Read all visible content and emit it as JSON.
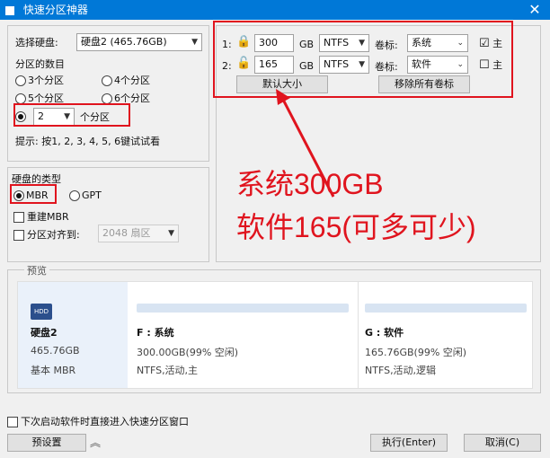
{
  "window": {
    "title": "快速分区神器",
    "close_glyph": "✕"
  },
  "disk": {
    "select_label": "选择硬盘:",
    "selected": "硬盘2 (465.76GB)",
    "count_label": "分区的数目",
    "options": [
      "3个分区",
      "4个分区",
      "5个分区",
      "6个分区"
    ],
    "custom_value": "2",
    "custom_suffix": "个分区",
    "hint": "提示: 按1, 2, 3, 4, 5, 6键试试看"
  },
  "disk_type": {
    "label": "硬盘的类型",
    "mbr": "MBR",
    "gpt": "GPT",
    "rebuild_mbr": "重建MBR",
    "align_label": "分区对齐到:",
    "align_value": "2048 扇区"
  },
  "partitions": [
    {
      "index": "1:",
      "size": "300",
      "unit": "GB",
      "fs": "NTFS",
      "label_caption": "卷标:",
      "label": "系统",
      "main_label": "主",
      "main_checked": "☑"
    },
    {
      "index": "2:",
      "size": "165",
      "unit": "GB",
      "fs": "NTFS",
      "label_caption": "卷标:",
      "label": "软件",
      "main_label": "主",
      "main_checked": "☐"
    }
  ],
  "partition_buttons": {
    "default_size": "默认大小",
    "remove_labels": "移除所有卷标"
  },
  "annotation": {
    "line1": "系统300GB",
    "line2": "软件165(可多可少)"
  },
  "preview": {
    "label": "预览",
    "disk_name": "硬盘2",
    "disk_size": "465.76GB",
    "disk_type": "基本 MBR",
    "parts": [
      {
        "title": "F : 系统",
        "size": "300.00GB(99% 空闲)",
        "info": "NTFS,活动,主"
      },
      {
        "title": "G : 软件",
        "size": "165.76GB(99% 空闲)",
        "info": "NTFS,活动,逻辑"
      }
    ]
  },
  "footer": {
    "auto_enter": "下次启动软件时直接进入快速分区窗口",
    "preset": "预设置",
    "execute": "执行(Enter)",
    "cancel": "取消(C)"
  },
  "colors": {
    "titlebar": "#0078d7",
    "highlight": "#e0141e",
    "bar": "#d8e4f2"
  }
}
